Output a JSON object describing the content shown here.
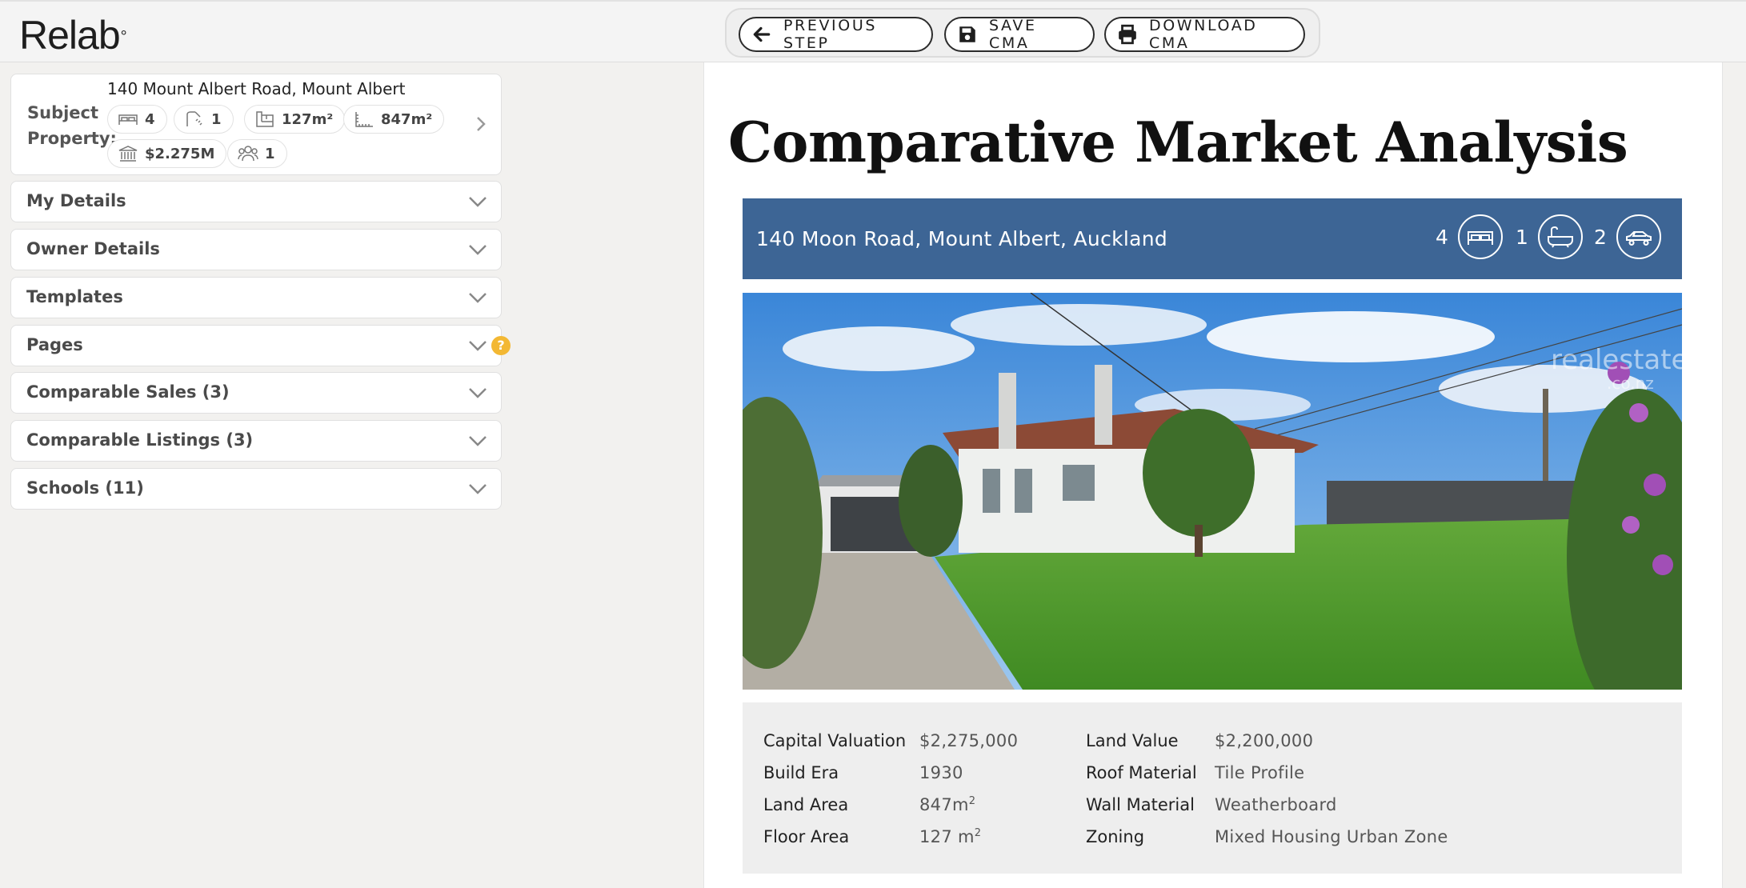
{
  "header": {
    "logo": "Relab",
    "logo_mark": "°",
    "buttons": {
      "previous": "PREVIOUS STEP",
      "save": "SAVE CMA",
      "download": "DOWNLOAD CMA"
    }
  },
  "sidebar": {
    "subject": {
      "label": "Subject Property:",
      "address": "140 Mount Albert Road, Mount Albert",
      "beds": "4",
      "baths": "1",
      "floor_area": "127m²",
      "land_area": "847m²",
      "valuation": "$2.275M",
      "owners": "1"
    },
    "sections": [
      "My Details",
      "Owner Details",
      "Templates",
      "Pages",
      "Comparable Sales (3)",
      "Comparable Listings (3)",
      "Schools (11)"
    ],
    "help_mark": "?"
  },
  "document": {
    "title": "Comparative Market Analysis",
    "address": "140 Moon Road, Mount Albert, Auckland",
    "beds": "4",
    "baths": "1",
    "cars": "2",
    "photo_watermark": "realestate",
    "photo_watermark_sub": ".co.nz",
    "details": {
      "capital_valuation_label": "Capital Valuation",
      "capital_valuation": "$2,275,000",
      "build_era_label": "Build Era",
      "build_era": "1930",
      "land_area_label": "Land Area",
      "land_area": "847m",
      "floor_area_label": "Floor Area",
      "floor_area": "127 m",
      "squared": "2",
      "land_value_label": "Land Value",
      "land_value": "$2,200,000",
      "roof_label": "Roof Material",
      "roof": "Tile Profile",
      "wall_label": "Wall Material",
      "wall": "Weatherboard",
      "zoning_label": "Zoning",
      "zoning": "Mixed Housing Urban Zone"
    }
  },
  "colors": {
    "address_bar": "#3d6595",
    "help_badge": "#f3b833",
    "background": "#f2f1ef"
  }
}
